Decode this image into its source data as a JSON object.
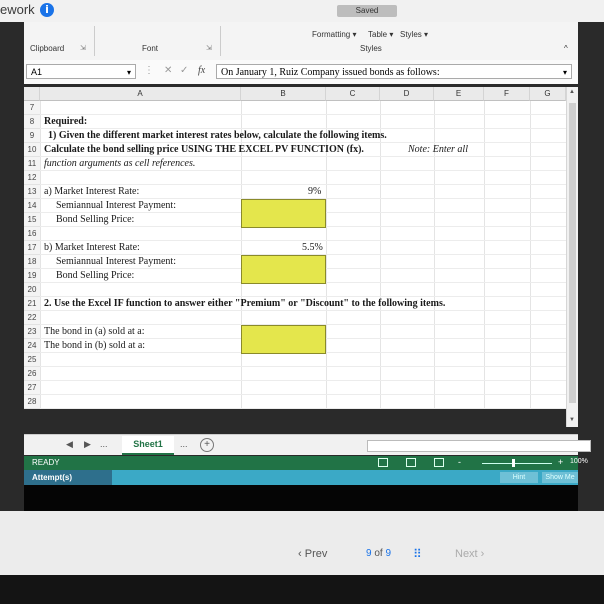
{
  "app": {
    "brand_fragment": "ework",
    "info_glyph": "i",
    "saved_label": "Saved"
  },
  "ribbon": {
    "formatting": "Formatting ▾",
    "table": "Table ▾",
    "styles_btn": "Styles ▾",
    "group_clipboard": "Clipboard",
    "group_font": "Font",
    "group_styles": "Styles",
    "launcher": "⇲",
    "collapse": "^"
  },
  "formula_bar": {
    "name_box": "A1",
    "dropdown": "▾",
    "menu": "⋮",
    "cancel": "✕",
    "enter": "✓",
    "fx": "fx",
    "content": "On January 1, Ruiz Company issued bonds as follows:"
  },
  "columns": [
    "A",
    "B",
    "C",
    "D",
    "E",
    "F",
    "G",
    "H"
  ],
  "rows": [
    "7",
    "8",
    "9",
    "10",
    "11",
    "12",
    "13",
    "14",
    "15",
    "16",
    "17",
    "18",
    "19",
    "20",
    "21",
    "22",
    "23",
    "24",
    "25",
    "26",
    "27",
    "28"
  ],
  "cells": {
    "r8": "Required:",
    "r9": "1) Given the different market interest rates below, calculate the following items.",
    "r10": "Calculate the bond selling price USING THE EXCEL PV FUNCTION (fx).",
    "r10_note": "Note: Enter all",
    "r11": "function arguments as cell references.",
    "r13": "a)  Market Interest Rate:",
    "r13_val": "9%",
    "r14": "Semiannual Interest Payment:",
    "r15": "Bond Selling Price:",
    "r17": "b)  Market Interest Rate:",
    "r17_val": "5.5%",
    "r18": "Semiannual Interest Payment:",
    "r19": "Bond Selling Price:",
    "r21": "2. Use the Excel IF function to answer either \"Premium\" or \"Discount\" to the following items.",
    "r23": "The bond in (a) sold at a:",
    "r24": "The bond in (b) sold at a:"
  },
  "tabs": {
    "first": "◀",
    "next": "▶",
    "more": "...",
    "sheet": "Sheet1",
    "more2": "...",
    "add": "+"
  },
  "status": {
    "ready": "READY",
    "zoom": "100%",
    "minus": "-",
    "plus": "+"
  },
  "attempt": {
    "label": "Attempt(s)",
    "hint": "Hint",
    "show_me": "Show Me"
  },
  "nav": {
    "prev": "Prev",
    "current": "9",
    "of": "of",
    "total": "9",
    "next": "Next",
    "grid_glyph": "⠿"
  }
}
